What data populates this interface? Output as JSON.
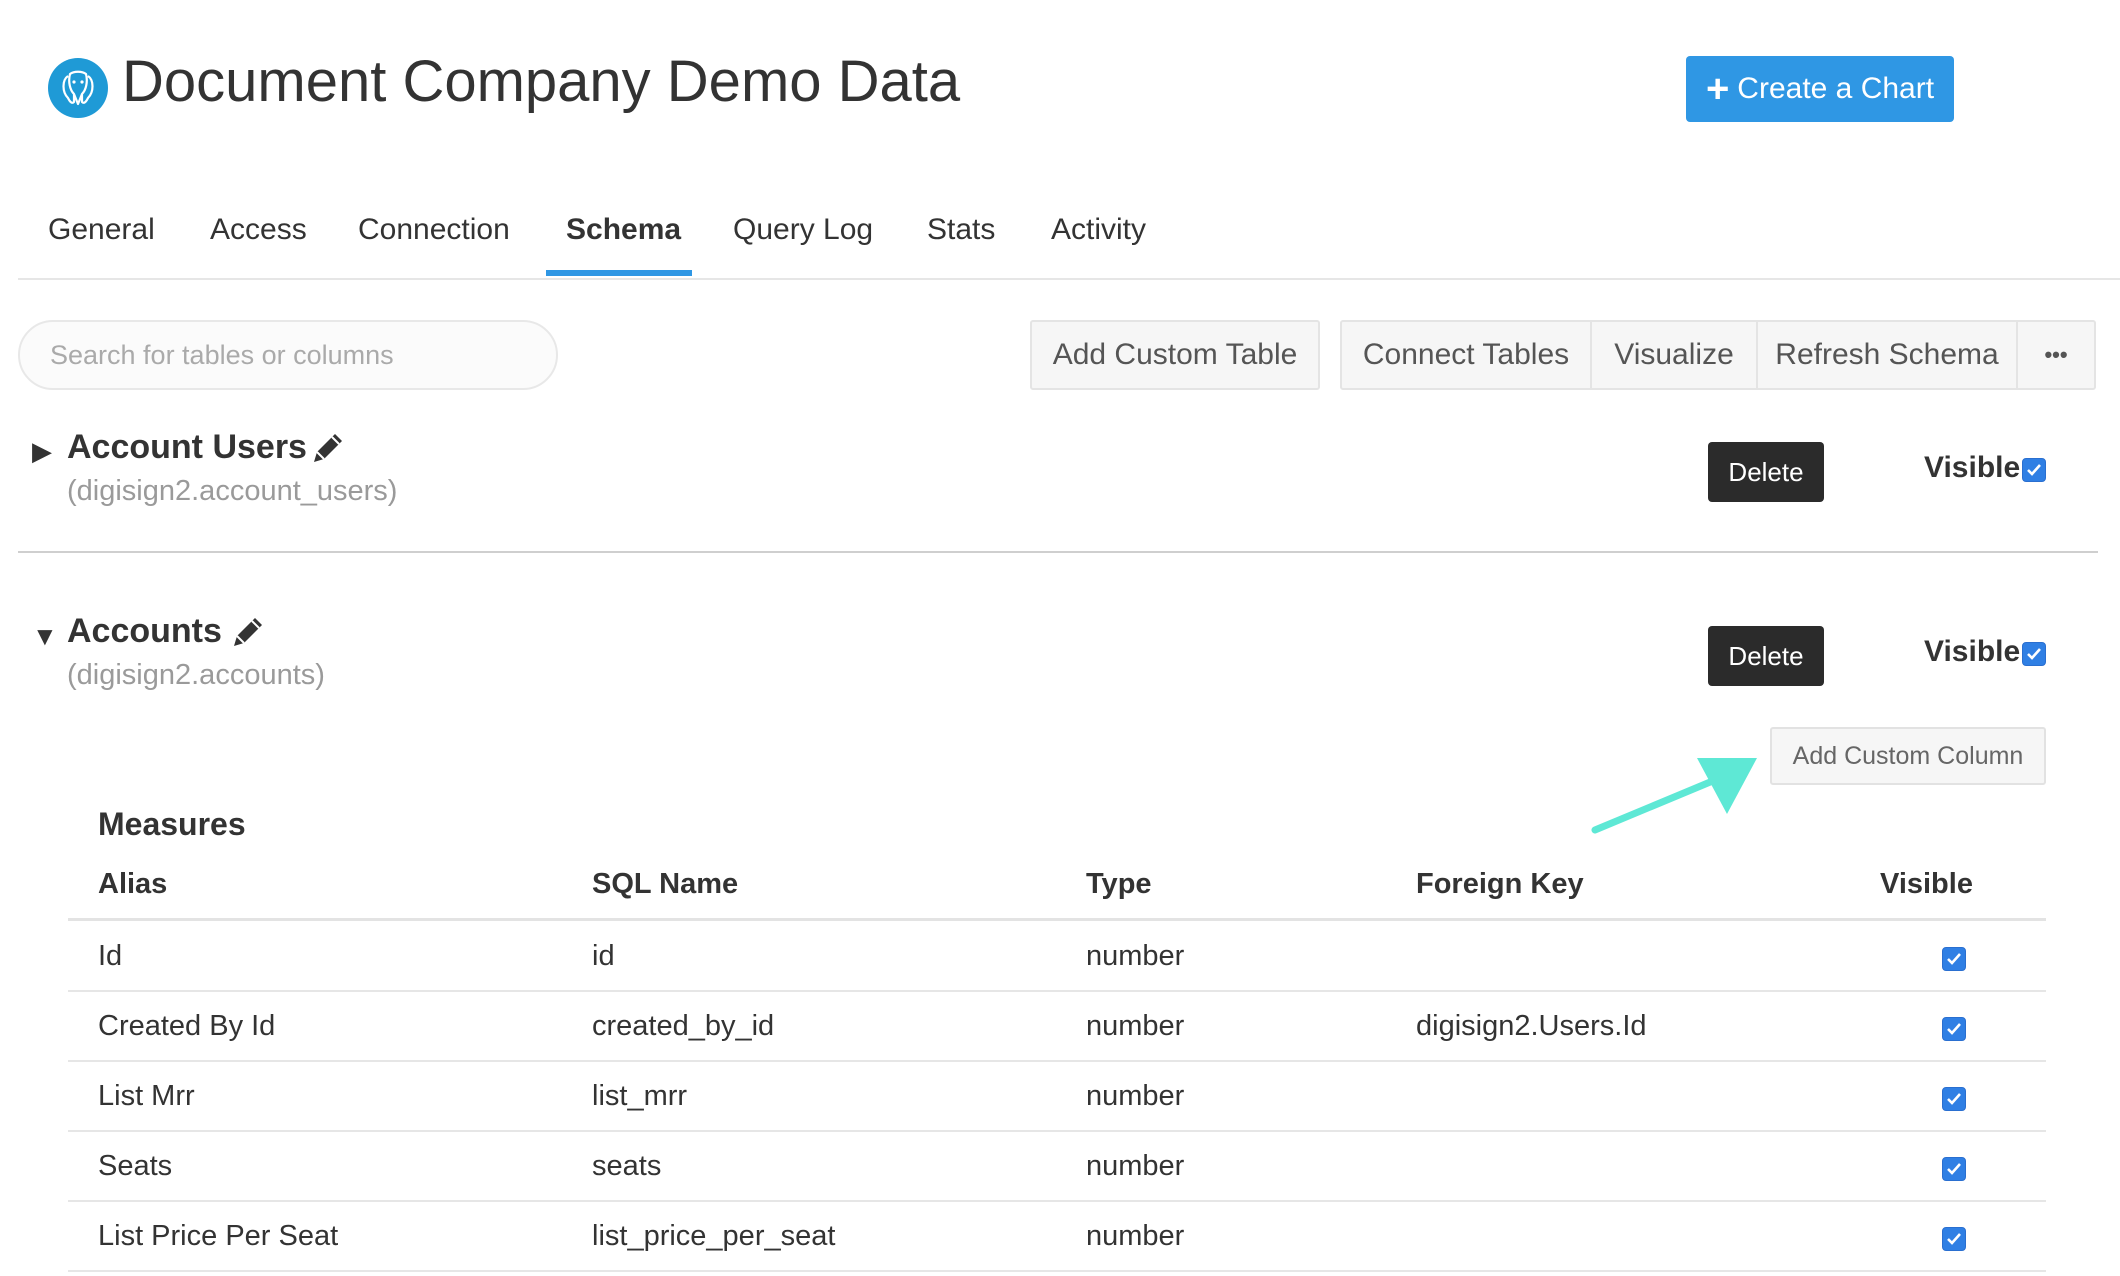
{
  "header": {
    "logo_icon": "postgres-elephant-icon",
    "title": "Document Company Demo Data",
    "create_chart_label": "Create a Chart",
    "create_chart_icon": "plus-icon",
    "accent_color": "#2f97e4"
  },
  "tabs": [
    {
      "label": "General"
    },
    {
      "label": "Access"
    },
    {
      "label": "Connection"
    },
    {
      "label": "Schema",
      "active": true
    },
    {
      "label": "Query Log"
    },
    {
      "label": "Stats"
    },
    {
      "label": "Activity"
    }
  ],
  "toolbar": {
    "search_placeholder": "Search for tables or columns",
    "add_custom_table": "Add Custom Table",
    "connect_tables": "Connect Tables",
    "visualize": "Visualize",
    "refresh_schema": "Refresh Schema",
    "more": "•••"
  },
  "tables": [
    {
      "name": "Account Users",
      "sql": "(digisign2.account_users)",
      "expanded": false,
      "delete_label": "Delete",
      "visible_label": "Visible",
      "visible": true
    },
    {
      "name": "Accounts",
      "sql": "(digisign2.accounts)",
      "expanded": true,
      "delete_label": "Delete",
      "visible_label": "Visible",
      "visible": true,
      "add_custom_column": "Add Custom Column",
      "measures_title": "Measures",
      "columns_header": {
        "alias": "Alias",
        "sql_name": "SQL Name",
        "type": "Type",
        "foreign_key": "Foreign Key",
        "visible": "Visible"
      },
      "rows": [
        {
          "alias": "Id",
          "sql_name": "id",
          "type": "number",
          "foreign_key": "",
          "visible": true
        },
        {
          "alias": "Created By Id",
          "sql_name": "created_by_id",
          "type": "number",
          "foreign_key": "digisign2.Users.Id",
          "visible": true
        },
        {
          "alias": "List Mrr",
          "sql_name": "list_mrr",
          "type": "number",
          "foreign_key": "",
          "visible": true
        },
        {
          "alias": "Seats",
          "sql_name": "seats",
          "type": "number",
          "foreign_key": "",
          "visible": true
        },
        {
          "alias": "List Price Per Seat",
          "sql_name": "list_price_per_seat",
          "type": "number",
          "foreign_key": "",
          "visible": true
        }
      ]
    }
  ],
  "annotation": {
    "arrow_color": "#5ee8d5",
    "arrow_icon": "pointer-arrow-icon"
  }
}
